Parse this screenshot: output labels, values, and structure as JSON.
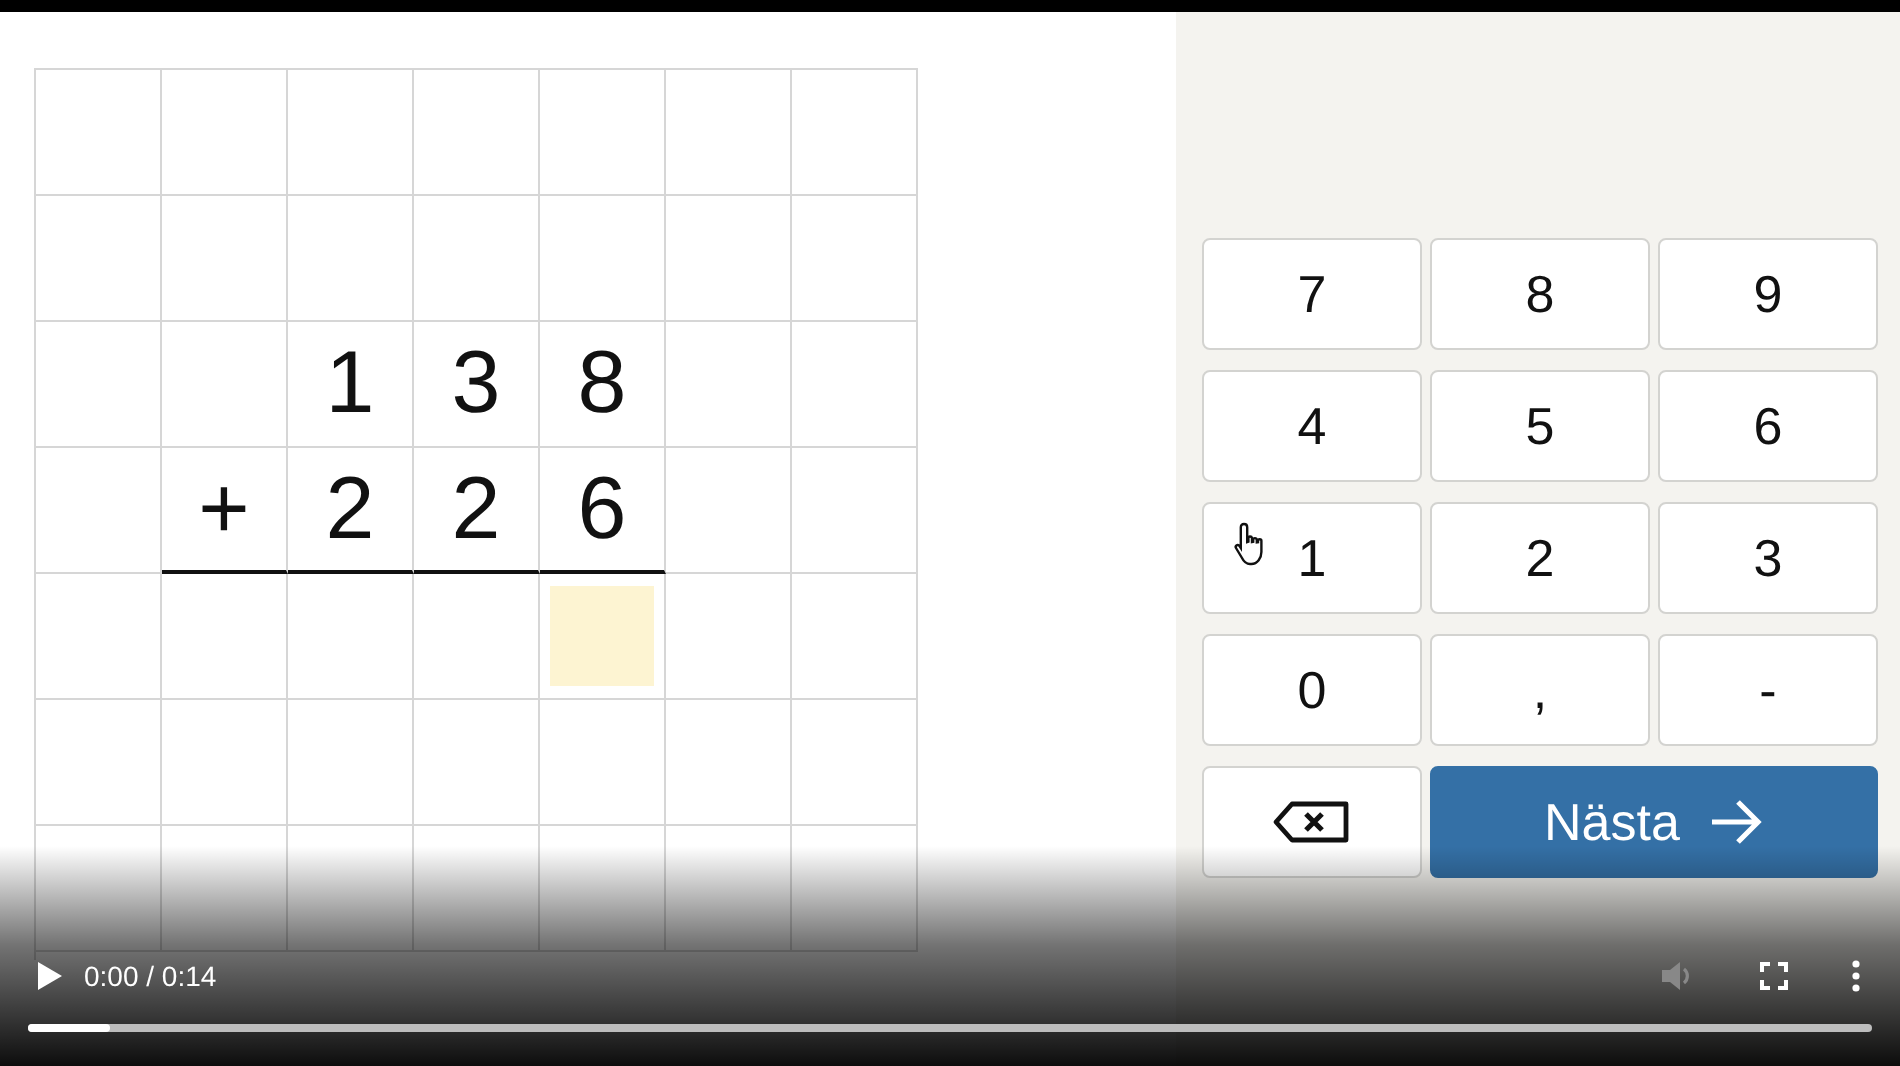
{
  "worksheet": {
    "rows": [
      [
        {
          "kind": "empty"
        },
        {
          "kind": "empty"
        },
        {
          "kind": "empty"
        },
        {
          "kind": "empty"
        },
        {
          "kind": "empty"
        },
        {
          "kind": "empty"
        },
        {
          "kind": "empty"
        }
      ],
      [
        {
          "kind": "empty"
        },
        {
          "kind": "empty"
        },
        {
          "kind": "empty"
        },
        {
          "kind": "empty"
        },
        {
          "kind": "empty"
        },
        {
          "kind": "empty"
        },
        {
          "kind": "empty"
        }
      ],
      [
        {
          "kind": "empty"
        },
        {
          "kind": "empty"
        },
        {
          "kind": "digit",
          "text": "1"
        },
        {
          "kind": "digit",
          "text": "3"
        },
        {
          "kind": "digit",
          "text": "8"
        },
        {
          "kind": "empty"
        },
        {
          "kind": "empty"
        }
      ],
      [
        {
          "kind": "empty"
        },
        {
          "kind": "digit",
          "text": "+",
          "underline": true
        },
        {
          "kind": "digit",
          "text": "2",
          "underline": true
        },
        {
          "kind": "digit",
          "text": "2",
          "underline": true
        },
        {
          "kind": "digit",
          "text": "6",
          "underline": true
        },
        {
          "kind": "empty"
        },
        {
          "kind": "empty"
        }
      ],
      [
        {
          "kind": "empty"
        },
        {
          "kind": "empty"
        },
        {
          "kind": "empty"
        },
        {
          "kind": "empty"
        },
        {
          "kind": "answer",
          "selected": true
        },
        {
          "kind": "empty"
        },
        {
          "kind": "empty"
        }
      ],
      [
        {
          "kind": "empty"
        },
        {
          "kind": "empty"
        },
        {
          "kind": "empty"
        },
        {
          "kind": "empty"
        },
        {
          "kind": "empty"
        },
        {
          "kind": "empty"
        },
        {
          "kind": "empty"
        }
      ],
      [
        {
          "kind": "empty"
        },
        {
          "kind": "empty"
        },
        {
          "kind": "empty"
        },
        {
          "kind": "empty"
        },
        {
          "kind": "empty"
        },
        {
          "kind": "empty"
        },
        {
          "kind": "empty"
        }
      ]
    ]
  },
  "keypad": {
    "keys": [
      {
        "kind": "key",
        "label": "7"
      },
      {
        "kind": "key",
        "label": "8"
      },
      {
        "kind": "key",
        "label": "9"
      },
      {
        "kind": "key",
        "label": "4"
      },
      {
        "kind": "key",
        "label": "5"
      },
      {
        "kind": "key",
        "label": "6"
      },
      {
        "kind": "key",
        "label": "1",
        "hovered": true
      },
      {
        "kind": "key",
        "label": "2"
      },
      {
        "kind": "key",
        "label": "3"
      },
      {
        "kind": "key",
        "label": "0"
      },
      {
        "kind": "key",
        "label": ","
      },
      {
        "kind": "key",
        "label": "-"
      },
      {
        "kind": "backspace"
      },
      {
        "kind": "next",
        "label": "Nästa"
      }
    ]
  },
  "player": {
    "playing": false,
    "time": "0:00 / 0:14",
    "muted": false,
    "volume_disabled": true,
    "progress": {
      "level": 0.045
    }
  }
}
